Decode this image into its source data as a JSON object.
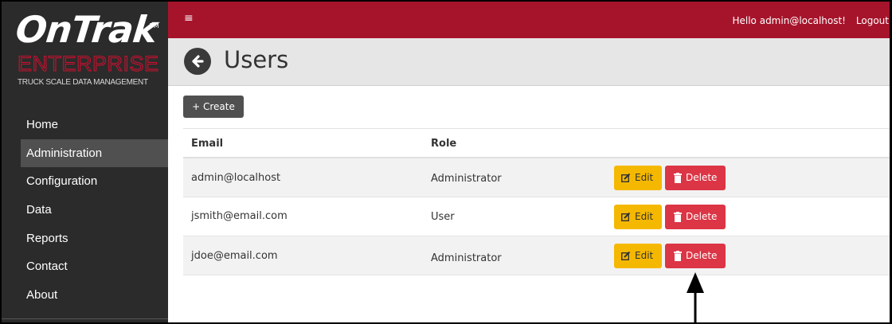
{
  "brand": {
    "logo_main": "OnTrak",
    "logo_tm": "TM",
    "logo_sub": "ENTERPRISE",
    "logo_tagline": "TRUCK SCALE DATA MANAGEMENT"
  },
  "sidebar": {
    "items": [
      {
        "label": "Home",
        "active": false
      },
      {
        "label": "Administration",
        "active": true
      },
      {
        "label": "Configuration",
        "active": false
      },
      {
        "label": "Data",
        "active": false
      },
      {
        "label": "Reports",
        "active": false
      },
      {
        "label": "Contact",
        "active": false
      },
      {
        "label": "About",
        "active": false
      }
    ]
  },
  "topbar": {
    "menu_icon": "hamburger-icon",
    "greeting": "Hello admin@localhost!",
    "logout_label": "Logout"
  },
  "header": {
    "back_icon": "arrow-left-circle-icon",
    "title": "Users"
  },
  "toolbar": {
    "create_label": "+ Create"
  },
  "table": {
    "columns": [
      "Email",
      "Role"
    ],
    "rows": [
      {
        "email": "admin@localhost",
        "role": "Administrator"
      },
      {
        "email": "jsmith@email.com",
        "role": "User"
      },
      {
        "email": "jdoe@email.com",
        "role": "Administrator"
      }
    ],
    "edit_label": "Edit",
    "delete_label": "Delete",
    "edit_icon": "edit-icon",
    "delete_icon": "trash-icon"
  },
  "colors": {
    "topbar": "#a6142b",
    "sidebar": "#2b2b2b",
    "edit_button": "#f5b800",
    "delete_button": "#dc3545"
  }
}
